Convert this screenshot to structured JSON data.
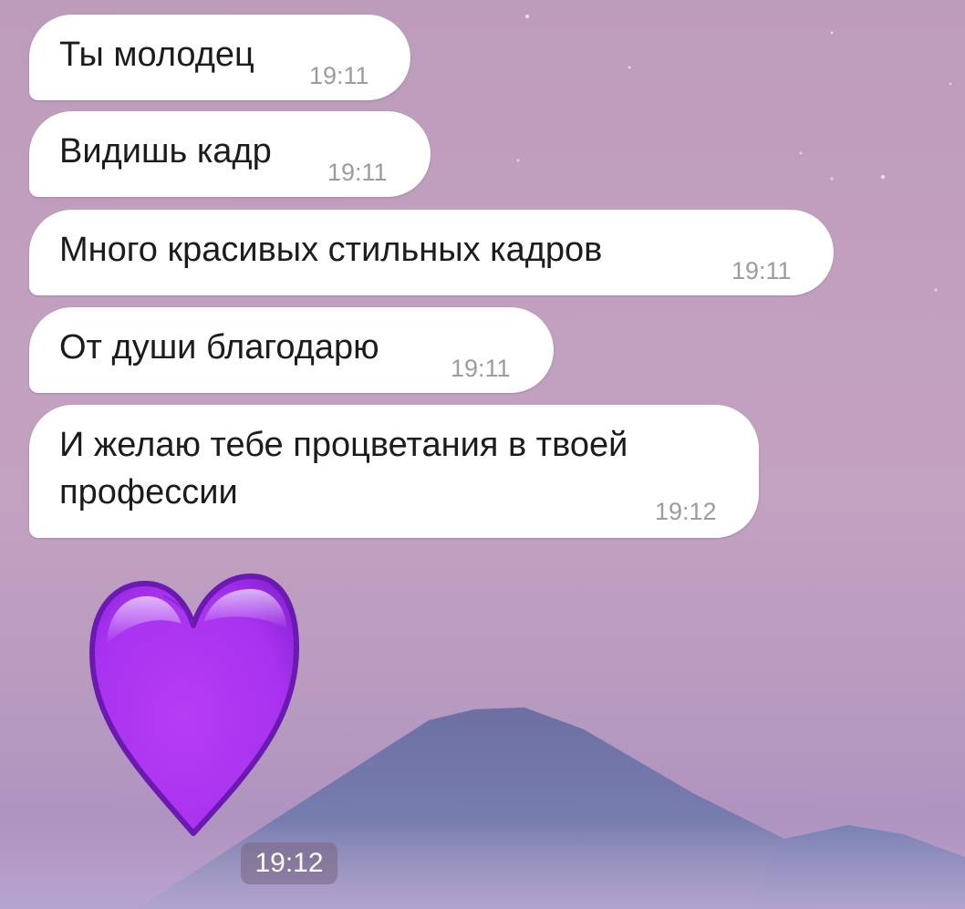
{
  "messages": [
    {
      "text": "Ты молодец",
      "time": "19:11"
    },
    {
      "text": "Видишь кадр",
      "time": "19:11"
    },
    {
      "text": "Много красивых стильных кадров",
      "time": "19:11"
    },
    {
      "text": "От души благодарю",
      "time": "19:11"
    },
    {
      "text_line1": "И желаю тебе процветания в твоей",
      "text_line2": "профессии",
      "time": "19:12"
    }
  ],
  "sticker": {
    "icon": "purple-heart-icon",
    "time": "19:12"
  },
  "colors": {
    "bubble": "#ffffff",
    "time_text": "#9b9ba2",
    "heart": "#a733f2",
    "background_top": "#bd9bbb",
    "mountain": "#6f78ac"
  }
}
